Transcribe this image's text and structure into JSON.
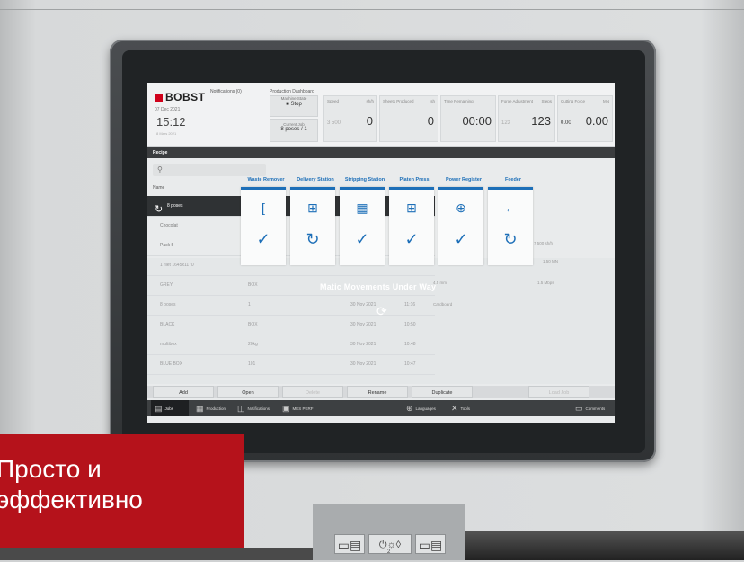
{
  "header": {
    "brand": "BOBST",
    "date": "07 Dec 2021",
    "time": "15:12",
    "small_date": "8 Mars 2021",
    "notifications": "Notifications (0)",
    "dashboard_title": "Production Dashboard",
    "machine_state_label": "Machine State",
    "machine_state": "Stop",
    "current_job_label": "Current Job",
    "current_job": "8 poses / 1",
    "speed_label": "Speed",
    "speed_unit": "sh/h",
    "speed_value": "0",
    "speed_target": "3 500",
    "sheets_label": "Sheets Produced",
    "sheets_unit": "sh",
    "sheets_value": "0",
    "time_label": "Time Remaining",
    "time_value": "00:00",
    "force_label": "Force Adjustment",
    "force_unit": "Steps",
    "force_value": "123",
    "force_small": "123",
    "cutting_label": "Cutting Force",
    "cutting_unit": "MN",
    "cutting_value": "0.00",
    "cutting_small": "0.00"
  },
  "recipe": {
    "bar_label": "Recipe",
    "search_placeholder": "",
    "name_header": "Name",
    "rows": [
      {
        "name": "8 poses",
        "col2": "",
        "date": "",
        "time": ""
      },
      {
        "name": "Chocolat",
        "col2": "",
        "date": "",
        "time": ""
      },
      {
        "name": "Pack 5",
        "col2": "",
        "date": "",
        "time": ""
      },
      {
        "name": "1 filet 1645x1170",
        "col2": "",
        "date": "",
        "time": ""
      },
      {
        "name": "GREY",
        "col2": "BOX",
        "date": "",
        "time": ""
      },
      {
        "name": "8 poses",
        "col2": "1",
        "date": "30 Nov 2021",
        "time": "11:16"
      },
      {
        "name": "BLACK",
        "col2": "BOX",
        "date": "30 Nov 2021",
        "time": "10:50"
      },
      {
        "name": "multibox",
        "col2": "20kg",
        "date": "30 Nov 2021",
        "time": "10:48"
      },
      {
        "name": "BLUE BOX",
        "col2": "101",
        "date": "30 Nov 2021",
        "time": "10:47"
      }
    ]
  },
  "stations": [
    {
      "title": "Waste Remover",
      "icon": "[",
      "status": "✓"
    },
    {
      "title": "Delivery Station",
      "icon": "⊞",
      "status": "↻"
    },
    {
      "title": "Stripping Station",
      "icon": "▦",
      "status": "✓"
    },
    {
      "title": "Platen Press",
      "icon": "⊞",
      "status": "✓"
    },
    {
      "title": "Power Register",
      "icon": "⊕",
      "status": "✓"
    },
    {
      "title": "Feeder",
      "icon": "←",
      "status": "↻"
    }
  ],
  "overlay": {
    "message": "Matic Movements Under Way"
  },
  "side": {
    "speed": "7 500 sh/h",
    "force": "1.50 MN",
    "sheets": "1.5 Mbps",
    "thickness": "4.5 mm",
    "material": "Cardboard"
  },
  "actions": {
    "add": "Add",
    "open": "Open",
    "delete": "Delete",
    "rename": "Rename",
    "duplicate": "Duplicate",
    "load_job": "Load Job"
  },
  "nav": {
    "jobs": "Jobs",
    "production": "Production",
    "notifications": "Notifications",
    "mes": "MES PERF",
    "languages": "Languages",
    "tools": "Tools",
    "comments": "Comments"
  },
  "banner": {
    "line1": "Просто и",
    "line2": "эффективно"
  },
  "panel": {
    "button_middle": "⏻☼◊",
    "button_middle_sub": "2"
  },
  "colors": {
    "brand_red": "#d0021b",
    "accent_blue": "#1d6fb8",
    "banner_red": "#b5121b"
  }
}
